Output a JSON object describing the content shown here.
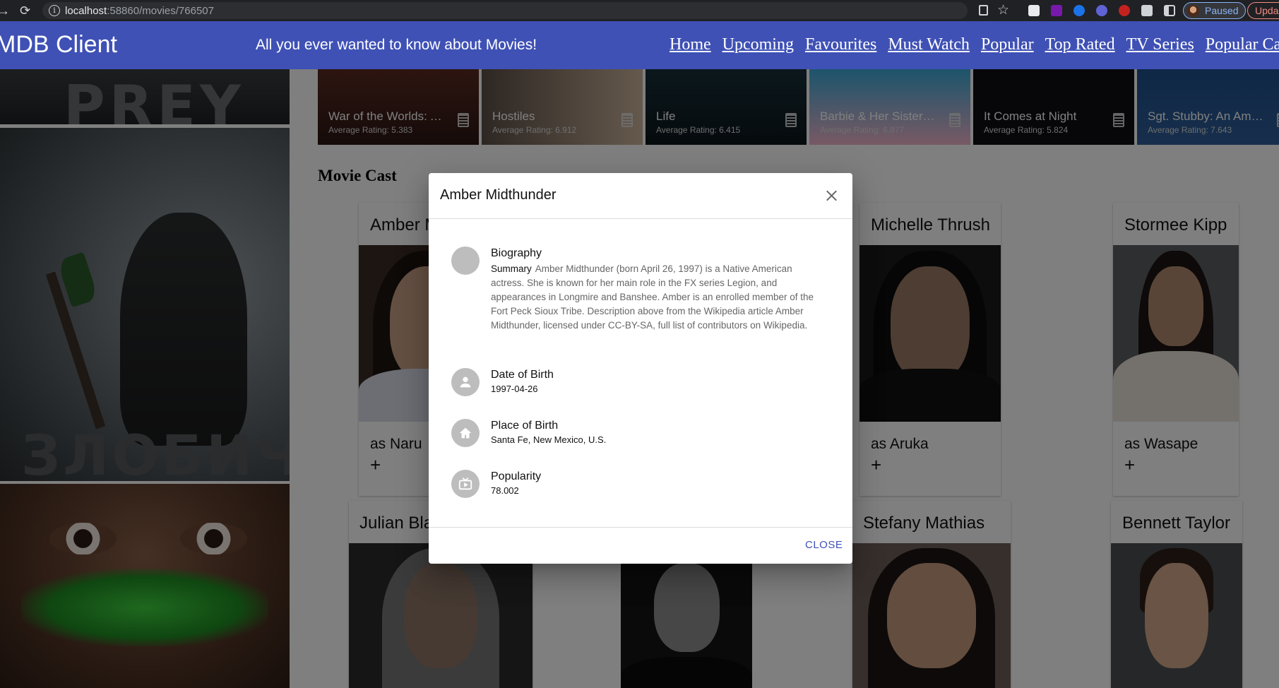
{
  "browser": {
    "url_host": "localhost",
    "url_rest": ":58860/movies/766507",
    "profile_label": "Paused",
    "update_label": "Upda"
  },
  "app": {
    "brand": "MDB Client",
    "tagline": "All you ever wanted to know about Movies!",
    "nav": [
      "Home",
      "Upcoming",
      "Favourites",
      "Must Watch",
      "Popular",
      "Top Rated",
      "TV Series",
      "Popular Ca"
    ]
  },
  "posters": {
    "top_text": "PREY",
    "mid_text": "ЗЛОБИЧ"
  },
  "similar_movies": [
    {
      "title": "War of the Worlds: A...",
      "rating": "Average Rating: 5.383"
    },
    {
      "title": "Hostiles",
      "rating": "Average Rating: 6.912"
    },
    {
      "title": "Life",
      "rating": "Average Rating: 6.415"
    },
    {
      "title": "Barbie & Her Sisters...",
      "rating": "Average Rating: 6.877"
    },
    {
      "title": "It Comes at Night",
      "rating": "Average Rating: 5.824"
    },
    {
      "title": "Sgt. Stubby: An Ame...",
      "rating": "Average Rating: 7.643"
    }
  ],
  "cast_section": {
    "title": "Movie Cast",
    "row1": [
      {
        "name": "Amber M",
        "role": "as Naru",
        "add": "+"
      },
      {
        "name": "Michelle Thrush",
        "role": "as Aruka",
        "add": "+"
      },
      {
        "name": "Stormee Kipp",
        "role": "as Wasape",
        "add": "+"
      }
    ],
    "row2": [
      {
        "name": "Julian Bla"
      },
      {
        "name": "Stefany Mathias"
      },
      {
        "name": "Bennett Taylor"
      }
    ]
  },
  "dialog": {
    "title": "Amber Midthunder",
    "biography_label": "Biography",
    "summary_label": "Summary",
    "summary_text": "Amber Midthunder (born April 26, 1997) is a Native American actress. She is known for her main role in the FX series Legion, and appearances in Longmire and Banshee. Amber is an enrolled member of the Fort Peck Sioux Tribe. Description above from the Wikipedia article Amber Midthunder, licensed under CC-BY-SA, full list of contributors on Wikipedia.",
    "dob_label": "Date of Birth",
    "dob_value": "1997-04-26",
    "pob_label": "Place of Birth",
    "pob_value": "Santa Fe, New Mexico, U.S.",
    "popularity_label": "Popularity",
    "popularity_value": "78.002",
    "close_label": "CLOSE"
  },
  "colors": {
    "appbar": "#3f51b5",
    "accent": "#3f51b5",
    "scrim": "rgba(0,0,0,0.5)"
  }
}
